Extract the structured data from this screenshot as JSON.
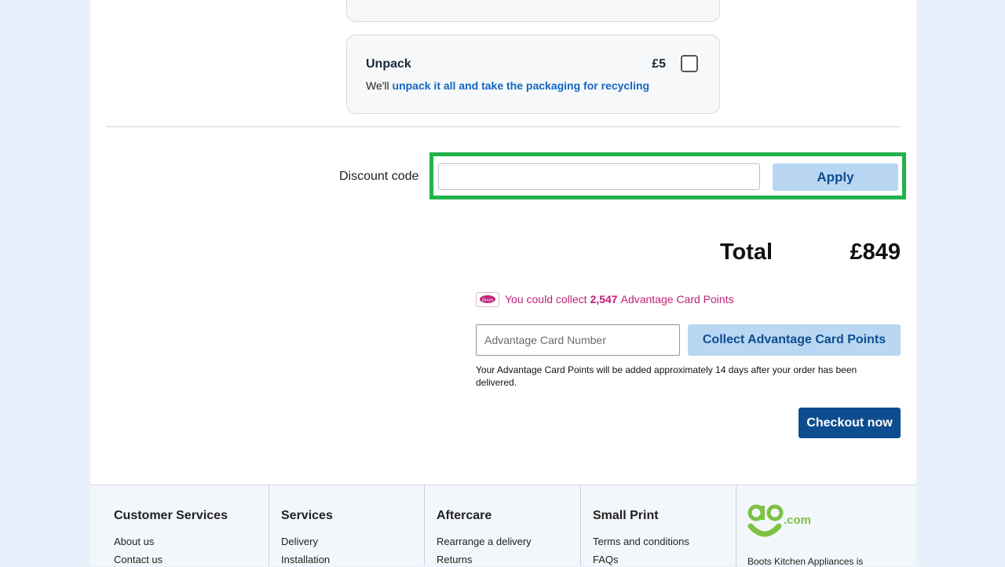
{
  "unpack": {
    "title": "Unpack",
    "price": "£5",
    "desc_prefix": "We'll ",
    "desc_highlight": "unpack it all and take the packaging for recycling"
  },
  "discount": {
    "label": "Discount code",
    "input_value": "",
    "apply_label": "Apply"
  },
  "total": {
    "label": "Total",
    "value": "£849"
  },
  "advantage": {
    "logo_text": "Boots",
    "prefix": "You could collect",
    "points": "2,547",
    "suffix": "Advantage Card Points",
    "input_placeholder": "Advantage Card Number",
    "collect_label": "Collect Advantage Card Points",
    "note": "Your Advantage Card Points will be added approximately 14 days after your order has been delivered."
  },
  "checkout_label": "Checkout now",
  "footer": {
    "cols": [
      {
        "title": "Customer Services",
        "links": [
          "About us",
          "Contact us"
        ]
      },
      {
        "title": "Services",
        "links": [
          "Delivery",
          "Installation"
        ]
      },
      {
        "title": "Aftercare",
        "links": [
          "Rearrange a delivery",
          "Returns"
        ]
      },
      {
        "title": "Small Print",
        "links": [
          "Terms and conditions",
          "FAQs"
        ]
      }
    ],
    "brand_text": "ao",
    "brand_suffix": ".com",
    "brand_note": "Boots Kitchen Appliances is"
  },
  "colors": {
    "primary": "#0d4d8f",
    "button_light": "#b9d7f3",
    "highlight_green": "#22b24c",
    "advantage_pink": "#c0217a",
    "ao_green": "#7dc243"
  }
}
